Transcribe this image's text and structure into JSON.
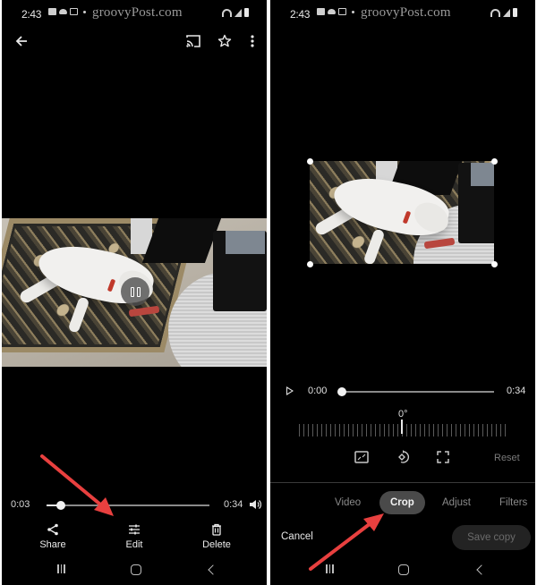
{
  "status_bar": {
    "time": "2:43",
    "watermark": "groovyPost.com",
    "left_icons": [
      "gallery-icon",
      "cloud-icon",
      "mail-icon",
      "dot-icon"
    ],
    "right_icons": [
      "wifi-icon",
      "signal-icon",
      "battery-icon"
    ]
  },
  "viewer": {
    "top_bar": {
      "back_icon": "arrow-left-icon",
      "actions": [
        "cast-icon",
        "star-icon",
        "more-vert-icon"
      ]
    },
    "video_state": "paused",
    "playback": {
      "current_time": "0:03",
      "duration": "0:34",
      "progress_fraction": 0.09
    },
    "actions": [
      {
        "label": "Share",
        "icon": "share-icon"
      },
      {
        "label": "Edit",
        "icon": "tune-icon"
      },
      {
        "label": "Delete",
        "icon": "trash-icon"
      }
    ]
  },
  "editor": {
    "playback": {
      "current_time": "0:00",
      "duration": "0:34",
      "progress_fraction": 0.0
    },
    "rotation": {
      "angle_label": "0°",
      "angle_degrees": 0
    },
    "tools": [
      "aspect-ratio-icon",
      "rotate-icon",
      "free-crop-icon"
    ],
    "reset_label": "Reset",
    "tabs": [
      {
        "label": "Video",
        "active": false
      },
      {
        "label": "Crop",
        "active": true
      },
      {
        "label": "Adjust",
        "active": false
      },
      {
        "label": "Filters",
        "active": false
      }
    ],
    "cancel_label": "Cancel",
    "save_label": "Save copy"
  },
  "nav_bar": {
    "buttons": [
      "recents-icon",
      "home-icon",
      "back-icon"
    ]
  },
  "annotations": {
    "arrow_color": "#e8403f",
    "arrows": [
      {
        "points_to": "Edit"
      },
      {
        "points_to": "Crop"
      }
    ]
  },
  "colors": {
    "background": "#000000",
    "active_tab": "#4a4a4a",
    "save_button_bg": "#232323",
    "text": "#e8e8e8",
    "muted_text": "#8a8a8a"
  }
}
